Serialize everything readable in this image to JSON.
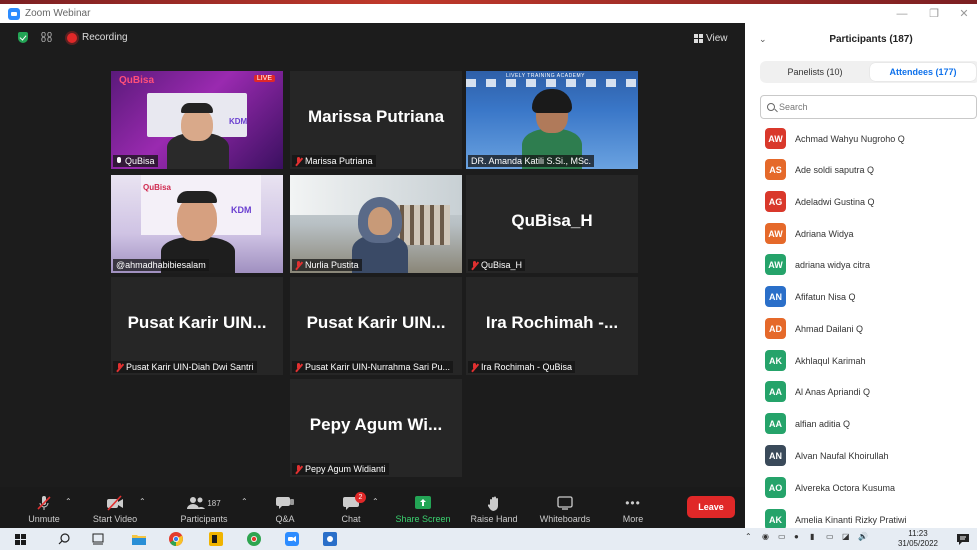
{
  "window": {
    "title": "Zoom Webinar"
  },
  "meeting_bar": {
    "recording_label": "Recording",
    "view_label": "View"
  },
  "tiles": [
    {
      "name": "QuBisa",
      "big": "",
      "video": true
    },
    {
      "name": "Marissa Putriana",
      "big": "Marissa Putriana",
      "video": false
    },
    {
      "name": "DR. Amanda Katili S.Si., MSc.",
      "big": "",
      "video": true
    },
    {
      "name": "@ahmadhabibiesalam",
      "big": "",
      "video": true
    },
    {
      "name": "Nurlia Pustita",
      "big": "",
      "video": true
    },
    {
      "name": "QuBisa_H",
      "big": "QuBisa_H",
      "video": false
    },
    {
      "name": "Pusat Karir UIN-Diah Dwi Santri",
      "big": "Pusat Karir UIN...",
      "video": false
    },
    {
      "name": "Pusat Karir UIN-Nurrahma Sari Pu...",
      "big": "Pusat Karir UIN...",
      "video": false
    },
    {
      "name": "Ira Rochimah - QuBisa",
      "big": "Ira Rochimah -...",
      "video": false
    },
    {
      "name": "Pepy Agum Widianti",
      "big": "Pepy Agum Wi...",
      "video": false
    }
  ],
  "tile_overlay": {
    "live_badge": "LIVE",
    "brand": "QuBisa",
    "academy_banner": "LIVELY TRAINING ACADEMY",
    "kdm": "KDM"
  },
  "toolbar": {
    "unmute": "Unmute",
    "start_video": "Start Video",
    "participants": "Participants",
    "participants_count": "187",
    "qa": "Q&A",
    "chat": "Chat",
    "chat_badge": "2",
    "share_screen": "Share Screen",
    "raise_hand": "Raise Hand",
    "whiteboards": "Whiteboards",
    "more": "More",
    "leave": "Leave"
  },
  "panel": {
    "title": "Participants (187)",
    "tab_panelists": "Panelists (10)",
    "tab_attendees": "Attendees (177)",
    "search_placeholder": "Search",
    "attendees": [
      {
        "initials": "AW",
        "name": "Achmad Wahyu Nugroho Q",
        "color": "#d9382b"
      },
      {
        "initials": "AS",
        "name": "Ade soldi saputra Q",
        "color": "#e5692a"
      },
      {
        "initials": "AG",
        "name": "Adeladwi Gustina Q",
        "color": "#d9382b"
      },
      {
        "initials": "AW",
        "name": "Adriana Widya",
        "color": "#e5692a"
      },
      {
        "initials": "AW",
        "name": "adriana widya citra",
        "color": "#25a36a"
      },
      {
        "initials": "AN",
        "name": "Afifatun Nisa Q",
        "color": "#2a6fc9"
      },
      {
        "initials": "AD",
        "name": "Ahmad Dailani Q",
        "color": "#e5692a"
      },
      {
        "initials": "AK",
        "name": "Akhlaqul Karimah",
        "color": "#25a36a"
      },
      {
        "initials": "AA",
        "name": "Al Anas Apriandi Q",
        "color": "#25a36a"
      },
      {
        "initials": "AA",
        "name": "alfian aditia Q",
        "color": "#25a36a"
      },
      {
        "initials": "AN",
        "name": "Alvan Naufal Khoirullah",
        "color": "#3a4a5a"
      },
      {
        "initials": "AO",
        "name": "Alvereka Octora Kusuma",
        "color": "#25a36a"
      },
      {
        "initials": "AK",
        "name": "Amelia Kinanti Rizky Pratiwi",
        "color": "#25a36a"
      }
    ]
  },
  "taskbar": {
    "time": "11:23",
    "date": "31/05/2022"
  }
}
